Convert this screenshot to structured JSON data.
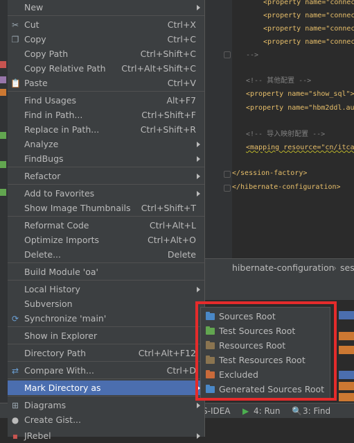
{
  "editor": {
    "lines": [
      "<property name=\"connec",
      "<property name=\"connec",
      "<property name=\"connec",
      "<property name=\"connec",
      "-->",
      "",
      "<!-- 其他配置 -->",
      "<property name=\"show_sql\">",
      "<property name=\"hbm2ddl.au",
      "",
      "<!-- 导入映射配置 -->",
      "<mapping resource=\"cn/itca",
      "",
      "</session-factory>",
      "</hibernate-configuration>"
    ],
    "breadcrumb": "hibernate-configuration",
    "breadcrumb_next": "ses"
  },
  "console_colors": {
    "accent": "#cc7832",
    "selection": "#4b6eaf"
  },
  "status_tabs": {
    "idea": "S-IDEA",
    "run": "4: Run",
    "find": "3: Find"
  },
  "menu": {
    "items": [
      {
        "label": "New",
        "shortcut": "",
        "arrow": true,
        "icon": ""
      },
      {
        "label": "Cut",
        "shortcut": "Ctrl+X",
        "arrow": false,
        "icon": "scissors-icon"
      },
      {
        "label": "Copy",
        "shortcut": "Ctrl+C",
        "arrow": false,
        "icon": "copy-icon"
      },
      {
        "label": "Copy Path",
        "shortcut": "Ctrl+Shift+C",
        "arrow": false,
        "icon": ""
      },
      {
        "label": "Copy Relative Path",
        "shortcut": "Ctrl+Alt+Shift+C",
        "arrow": false,
        "icon": ""
      },
      {
        "label": "Paste",
        "shortcut": "Ctrl+V",
        "arrow": false,
        "icon": "paste-icon"
      },
      {
        "label": "Find Usages",
        "shortcut": "Alt+F7",
        "arrow": false,
        "icon": ""
      },
      {
        "label": "Find in Path...",
        "shortcut": "Ctrl+Shift+F",
        "arrow": false,
        "icon": ""
      },
      {
        "label": "Replace in Path...",
        "shortcut": "Ctrl+Shift+R",
        "arrow": false,
        "icon": ""
      },
      {
        "label": "Analyze",
        "shortcut": "",
        "arrow": true,
        "icon": ""
      },
      {
        "label": "FindBugs",
        "shortcut": "",
        "arrow": true,
        "icon": ""
      },
      {
        "label": "Refactor",
        "shortcut": "",
        "arrow": true,
        "icon": ""
      },
      {
        "label": "Add to Favorites",
        "shortcut": "",
        "arrow": true,
        "icon": ""
      },
      {
        "label": "Show Image Thumbnails",
        "shortcut": "Ctrl+Shift+T",
        "arrow": false,
        "icon": ""
      },
      {
        "label": "Reformat Code",
        "shortcut": "Ctrl+Alt+L",
        "arrow": false,
        "icon": ""
      },
      {
        "label": "Optimize Imports",
        "shortcut": "Ctrl+Alt+O",
        "arrow": false,
        "icon": ""
      },
      {
        "label": "Delete...",
        "shortcut": "Delete",
        "arrow": false,
        "icon": ""
      },
      {
        "label": "Build Module 'oa'",
        "shortcut": "",
        "arrow": false,
        "icon": ""
      },
      {
        "label": "Local History",
        "shortcut": "",
        "arrow": true,
        "icon": ""
      },
      {
        "label": "Subversion",
        "shortcut": "",
        "arrow": false,
        "icon": ""
      },
      {
        "label": "Synchronize 'main'",
        "shortcut": "",
        "arrow": false,
        "icon": "sync-icon"
      },
      {
        "label": "Show in Explorer",
        "shortcut": "",
        "arrow": false,
        "icon": ""
      },
      {
        "label": "Directory Path",
        "shortcut": "Ctrl+Alt+F12",
        "arrow": false,
        "icon": ""
      },
      {
        "label": "Compare With...",
        "shortcut": "Ctrl+D",
        "arrow": false,
        "icon": "compare-icon"
      },
      {
        "label": "Mark Directory as",
        "shortcut": "",
        "arrow": true,
        "icon": "",
        "selected": true
      },
      {
        "label": "Diagrams",
        "shortcut": "",
        "arrow": true,
        "icon": "diagram-icon"
      },
      {
        "label": "Create Gist...",
        "shortcut": "",
        "arrow": false,
        "icon": "github-icon"
      },
      {
        "label": "JRebel",
        "shortcut": "",
        "arrow": true,
        "icon": "jrebel-icon"
      }
    ]
  },
  "submenu": {
    "items": [
      {
        "label": "Sources Root",
        "color": "#4a88c7"
      },
      {
        "label": "Test Sources Root",
        "color": "#62a650"
      },
      {
        "label": "Resources Root",
        "color": "#8a7450"
      },
      {
        "label": "Test Resources Root",
        "color": "#8a7450"
      },
      {
        "label": "Excluded",
        "color": "#c96a3a"
      },
      {
        "label": "Generated Sources Root",
        "color": "#4a88c7"
      }
    ]
  }
}
